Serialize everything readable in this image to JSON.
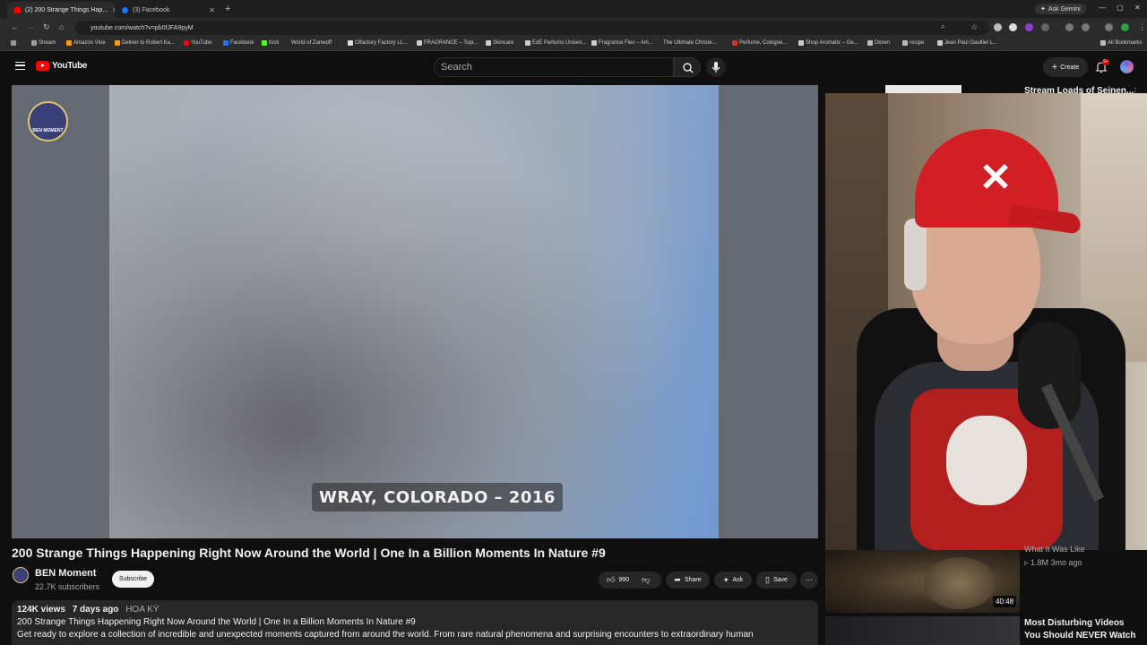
{
  "browser": {
    "tabs": [
      {
        "label": "(2) 200 Strange Things Hap...",
        "active": true
      },
      {
        "label": "(3) Facebook",
        "active": false
      }
    ],
    "new_tab": "+",
    "gemini_label": "Ask Gemini",
    "url": "youtube.com/watch?v=pb0fJFA9pyM",
    "bookmarks": [
      "Stream",
      "Amazon Vine",
      "Deliver to Robert Ka...",
      "YouTube",
      "Facebook",
      "Kick",
      "World of Zanwoff",
      "Olfactory Factory LL...",
      "FRAGRANCE – Topi...",
      "Skincare",
      "EdE Parfums Unisex...",
      "Fragrance Flex – Am...",
      "The Ultimate Christe...",
      "Perfume, Cologne...",
      "Shop Aromatix – Ge...",
      "Dtown",
      "recipe",
      "Jean Paul Gaultier L...",
      "All Bookmarks"
    ]
  },
  "header": {
    "logo_text": "YouTube",
    "search_placeholder": "Search",
    "create_label": "Create",
    "notifications": "9+"
  },
  "player": {
    "channel_watermark": "BEN MOMENT",
    "caption": "WRAY, COLORADO – 2016"
  },
  "video": {
    "title": "200 Strange Things Happening Right Now Around the World | One In a Billion Moments In Nature #9",
    "channel": "BEN Moment",
    "subscribers": "22.7K subscribers",
    "subscribe_label": "Subscribe",
    "likes": "990",
    "share_label": "Share",
    "ask_label": "Ask",
    "save_label": "Save",
    "more_label": "⋯",
    "views": "124K views",
    "age": "7 days ago",
    "location": "HOA KỲ",
    "desc_line1": "200 Strange Things Happening Right Now Around the World | One In a Billion Moments In Nature #9",
    "desc_line2": "Get ready to explore a collection of incredible and unexpected moments captured from around the world. From rare natural phenomena and surprising encounters to extraordinary human"
  },
  "sidebar": {
    "item0_title": "Stream Loads of Seinen...",
    "item1_title": "What It Was Like",
    "item1_meta": "▹ 1.8M  3mo ago",
    "item1_duration": "40:48",
    "item2_title": "Most Disturbing Videos You Should NEVER Watch"
  },
  "colors": {
    "accent": "#ff0000",
    "background": "#0f0f0f",
    "surface": "#272727"
  }
}
